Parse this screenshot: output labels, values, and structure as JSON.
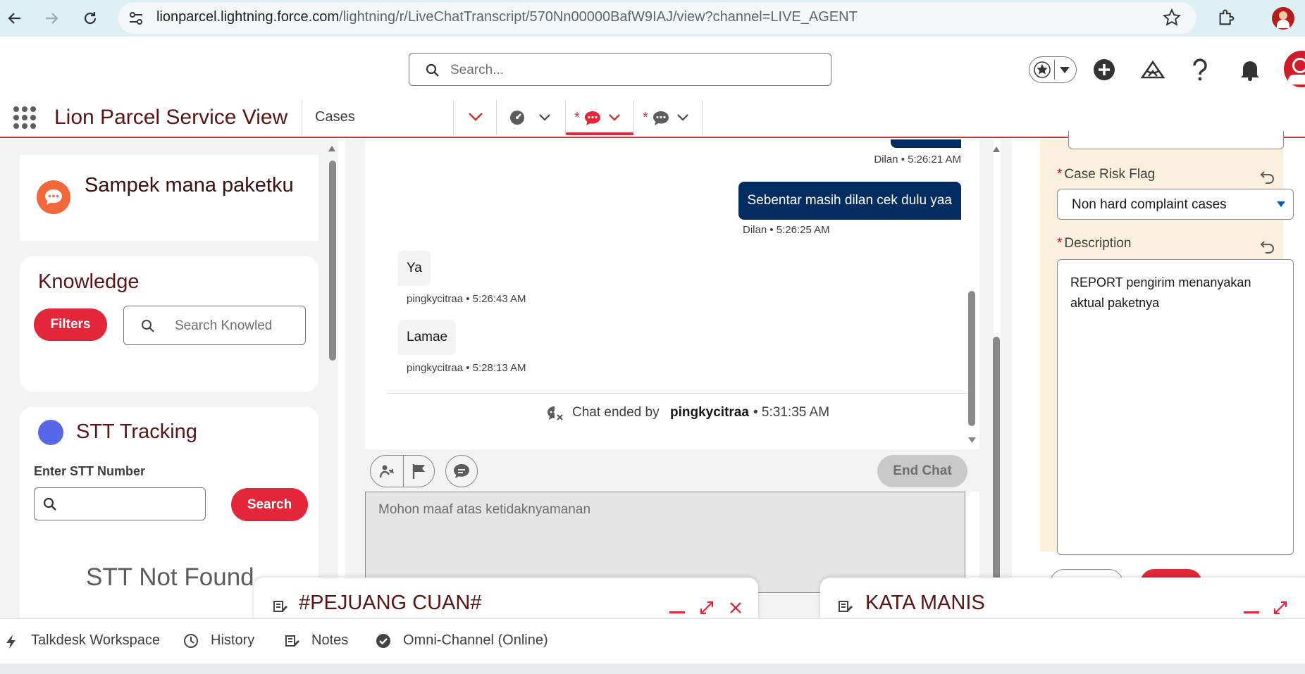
{
  "browser": {
    "url_host": "lionparcel.lightning.force.com",
    "url_path": "/lightning/r/LiveChatTranscript/570Nn00000BafW9IAJ/view?channel=LIVE_AGENT",
    "back_icon": "arrow-left-icon",
    "forward_icon": "arrow-right-icon",
    "reload_icon": "reload-icon",
    "bookmark_icon": "star-icon",
    "extensions_icon": "puzzle-icon"
  },
  "header": {
    "search_placeholder": "Search...",
    "icons": [
      "favorites-star-icon",
      "add-icon",
      "trailhead-icon",
      "help-icon",
      "bell-icon",
      "avatar"
    ]
  },
  "app_nav": {
    "app_name": "Lion Parcel Service View",
    "nav_item": "Cases",
    "tabs": [
      {
        "icon": "dropdown-chevron-icon",
        "unsaved": ""
      },
      {
        "icon": "case-gauge-icon",
        "unsaved": ""
      },
      {
        "icon": "chat-icon",
        "unsaved": "*",
        "active": true
      },
      {
        "icon": "chat-icon",
        "unsaved": "*"
      }
    ]
  },
  "left": {
    "chat_card_title": "Sampek mana paketku",
    "knowledge": {
      "title": "Knowledge",
      "filters_label": "Filters",
      "search_placeholder": "Search Knowled"
    },
    "stt": {
      "title": "STT Tracking",
      "input_label": "Enter STT Number",
      "search_label": "Search",
      "not_found": "STT Not Found"
    }
  },
  "chat": {
    "messages": [
      {
        "sender": "agent",
        "meta": "Dilan • 5:26:21 AM"
      },
      {
        "sender": "agent",
        "text": "Sebentar masih dilan cek dulu yaa",
        "meta": "Dilan • 5:26:25 AM"
      },
      {
        "sender": "customer",
        "text": "Ya",
        "meta": "pingkycitraa • 5:26:43 AM"
      },
      {
        "sender": "customer",
        "text": "Lamae",
        "meta": "pingkycitraa • 5:28:13 AM"
      }
    ],
    "ended_prefix": "Chat ended by",
    "ended_by": "pingkycitraa",
    "ended_time": "• 5:31:35 AM",
    "end_chat_label": "End Chat",
    "composer_text": "Mohon maaf atas ketidaknyamanan"
  },
  "case_form": {
    "risk_flag_label": "Case Risk Flag",
    "risk_flag_value": "Non hard complaint cases",
    "description_label": "Description",
    "description_value": "REPORT pengirim menanyakan aktual paketnya",
    "required_mark": "*"
  },
  "floating_panels": [
    {
      "title": "#PEJUANG CUAN#"
    },
    {
      "title": "KATA MANIS"
    }
  ],
  "utility_bar": {
    "items": [
      {
        "label": "Talkdesk Workspace",
        "icon": "bolt-icon"
      },
      {
        "label": "History",
        "icon": "clock-icon"
      },
      {
        "label": "Notes",
        "icon": "notes-icon"
      },
      {
        "label": "Omni-Channel (Online)",
        "icon": "check-circle-icon"
      }
    ]
  },
  "colors": {
    "brand_red": "#e3263a",
    "agent_bubble": "#032d60",
    "form_bg": "#fbf0dd",
    "app_name": "#5b1515"
  }
}
